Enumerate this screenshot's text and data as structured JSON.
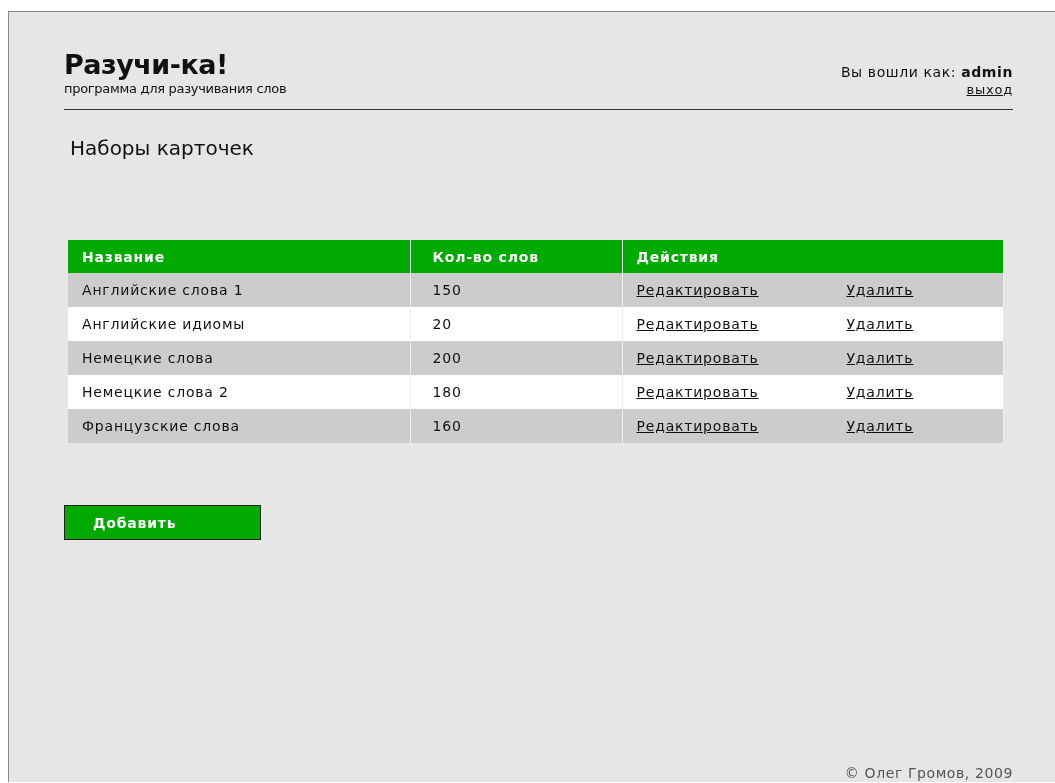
{
  "header": {
    "title": "Разучи-ка!",
    "subtitle": "программа для разучивания слов",
    "login_label": "Вы вошли как:",
    "username": "admin",
    "logout": "выход"
  },
  "page_title": "Наборы карточек",
  "table": {
    "columns": [
      "Название",
      "Кол-во слов",
      "Действия"
    ],
    "rows": [
      {
        "name": "Английские слова 1",
        "count": "150",
        "edit": "Редактировать",
        "delete": "Удалить"
      },
      {
        "name": "Английские идиомы",
        "count": "20",
        "edit": "Редактировать",
        "delete": "Удалить"
      },
      {
        "name": "Немецкие слова",
        "count": "200",
        "edit": "Редактировать",
        "delete": "Удалить"
      },
      {
        "name": "Немецкие слова 2",
        "count": "180",
        "edit": "Редактировать",
        "delete": "Удалить"
      },
      {
        "name": "Французские слова",
        "count": "160",
        "edit": "Редактировать",
        "delete": "Удалить"
      }
    ]
  },
  "add_button": "Добавить",
  "footer": "© Олег Громов, 2009"
}
